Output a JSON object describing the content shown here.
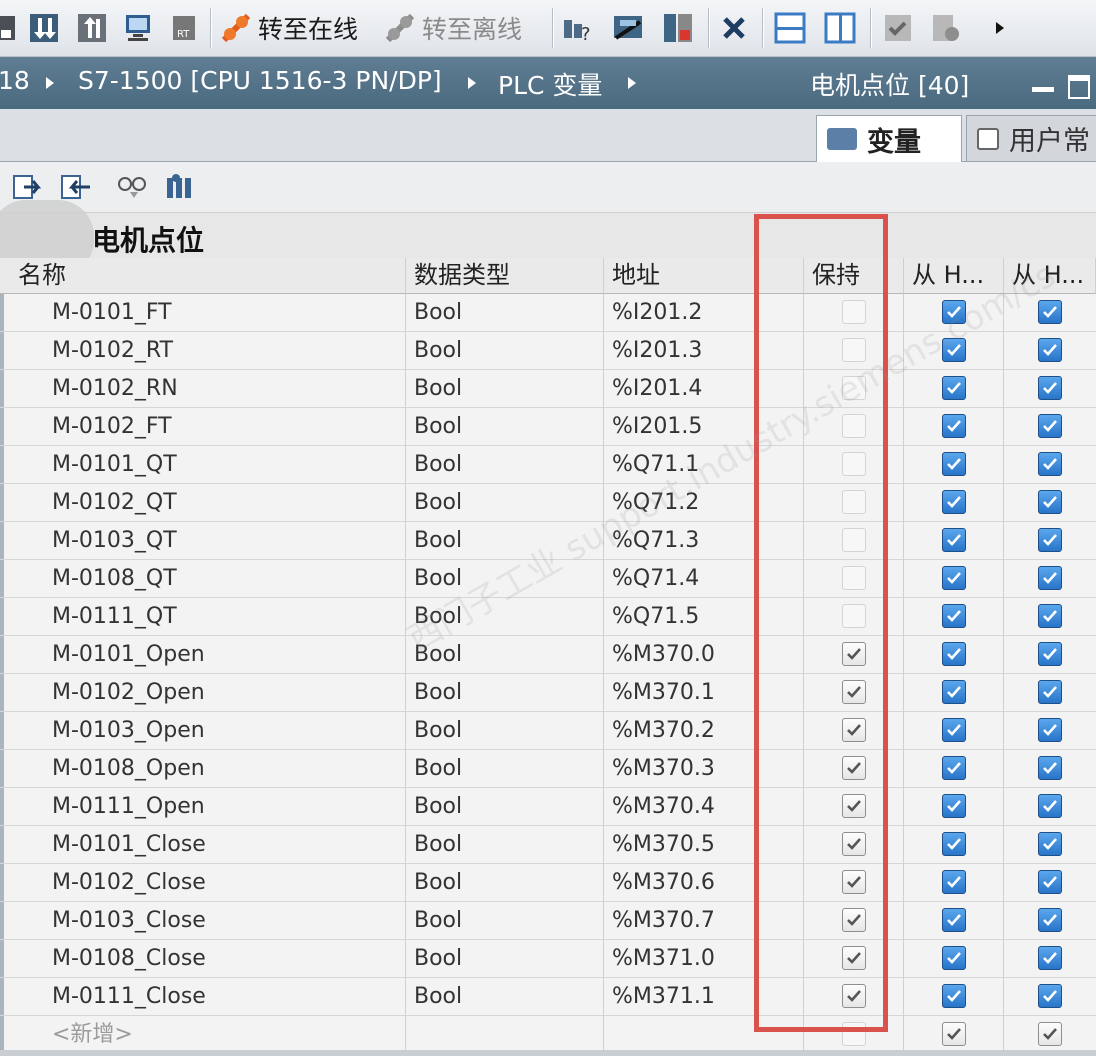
{
  "toolbar": {
    "go_online_label": "转至在线",
    "go_offline_label": "转至离线"
  },
  "breadcrumb": {
    "items": [
      "18",
      "S7-1500 [CPU 1516-3 PN/DP]",
      "PLC 变量",
      "电机点位 [40]"
    ]
  },
  "tabs": [
    {
      "label": "变量"
    },
    {
      "label": "用户常"
    }
  ],
  "grid": {
    "title": "电机点位",
    "columns": [
      "名称",
      "数据类型",
      "地址",
      "保持",
      "从 H...",
      "从 H..."
    ],
    "rows": [
      {
        "name": "M-0101_FT",
        "type": "Bool",
        "address": "%I201.2",
        "retain": false
      },
      {
        "name": "M-0102_RT",
        "type": "Bool",
        "address": "%I201.3",
        "retain": false
      },
      {
        "name": "M-0102_RN",
        "type": "Bool",
        "address": "%I201.4",
        "retain": false
      },
      {
        "name": "M-0102_FT",
        "type": "Bool",
        "address": "%I201.5",
        "retain": false
      },
      {
        "name": "M-0101_QT",
        "type": "Bool",
        "address": "%Q71.1",
        "retain": false
      },
      {
        "name": "M-0102_QT",
        "type": "Bool",
        "address": "%Q71.2",
        "retain": false
      },
      {
        "name": "M-0103_QT",
        "type": "Bool",
        "address": "%Q71.3",
        "retain": false
      },
      {
        "name": "M-0108_QT",
        "type": "Bool",
        "address": "%Q71.4",
        "retain": false
      },
      {
        "name": "M-0111_QT",
        "type": "Bool",
        "address": "%Q71.5",
        "retain": false
      },
      {
        "name": "M-0101_Open",
        "type": "Bool",
        "address": "%M370.0",
        "retain": true
      },
      {
        "name": "M-0102_Open",
        "type": "Bool",
        "address": "%M370.1",
        "retain": true
      },
      {
        "name": "M-0103_Open",
        "type": "Bool",
        "address": "%M370.2",
        "retain": true
      },
      {
        "name": "M-0108_Open",
        "type": "Bool",
        "address": "%M370.3",
        "retain": true
      },
      {
        "name": "M-0111_Open",
        "type": "Bool",
        "address": "%M370.4",
        "retain": true
      },
      {
        "name": "M-0101_Close",
        "type": "Bool",
        "address": "%M370.5",
        "retain": true
      },
      {
        "name": "M-0102_Close",
        "type": "Bool",
        "address": "%M370.6",
        "retain": true
      },
      {
        "name": "M-0103_Close",
        "type": "Bool",
        "address": "%M370.7",
        "retain": true
      },
      {
        "name": "M-0108_Close",
        "type": "Bool",
        "address": "%M371.0",
        "retain": true
      },
      {
        "name": "M-0111_Close",
        "type": "Bool",
        "address": "%M371.1",
        "retain": true
      }
    ],
    "new_row_label": "<新增>"
  },
  "watermark": "西门子工业 support.industry.siemens.com/cs",
  "colors": {
    "highlight": "#d9524c",
    "breadcrumb_bg": "#4f6f85",
    "checkbox_blue": "#2874c8"
  }
}
